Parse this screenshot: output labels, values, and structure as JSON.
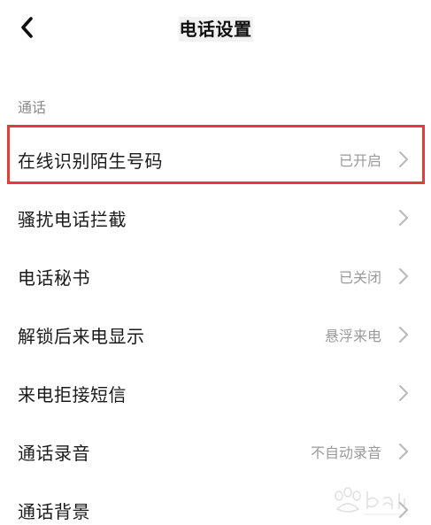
{
  "header": {
    "title": "电话设置",
    "back_icon": "chevron-left-icon"
  },
  "section": {
    "title": "通话"
  },
  "settings": [
    {
      "label": "在线识别陌生号码",
      "value": "已开启",
      "highlighted": true
    },
    {
      "label": "骚扰电话拦截",
      "value": ""
    },
    {
      "label": "电话秘书",
      "value": "已关闭"
    },
    {
      "label": "解锁后来电显示",
      "value": "悬浮来电"
    },
    {
      "label": "来电拒接短信",
      "value": ""
    },
    {
      "label": "通话录音",
      "value": "不自动录音"
    },
    {
      "label": "通话背景",
      "value": ""
    }
  ],
  "colors": {
    "highlight": "#e23b3b",
    "label": "#1a1a1a",
    "value": "#9a9a9a",
    "section": "#8a8a8a"
  }
}
